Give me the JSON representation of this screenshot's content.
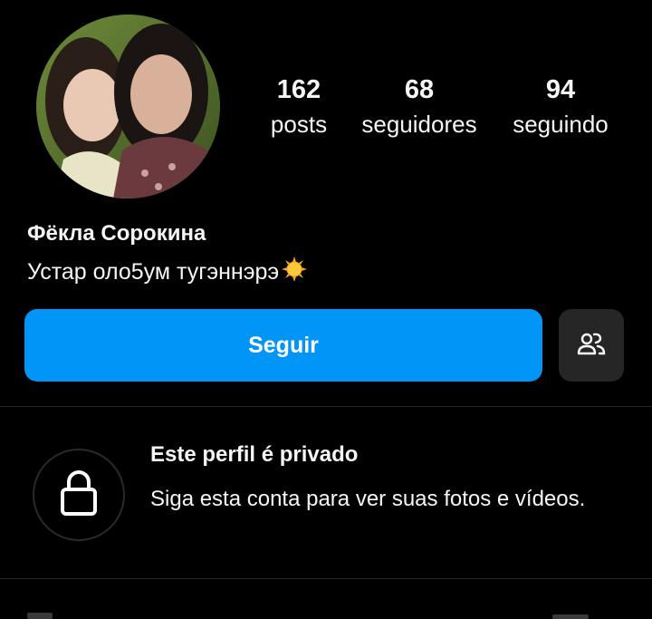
{
  "profile": {
    "name": "Фёкла Сорокина",
    "bio": "Устар оло5ум тугэннэрэ",
    "bio_emoji_icon": "sun-icon"
  },
  "stats": {
    "posts": {
      "count": "162",
      "label": "posts"
    },
    "followers": {
      "count": "68",
      "label": "seguidores"
    },
    "following": {
      "count": "94",
      "label": "seguindo"
    }
  },
  "actions": {
    "follow_label": "Seguir",
    "suggested_icon": "people-icon"
  },
  "private_notice": {
    "icon": "lock-icon",
    "title": "Este perfil é privado",
    "description": "Siga esta conta para ver suas fotos e vídeos."
  },
  "colors": {
    "background": "#000000",
    "accent": "#0095f6",
    "secondary_button": "#262626",
    "text": "#f5f5f5"
  }
}
